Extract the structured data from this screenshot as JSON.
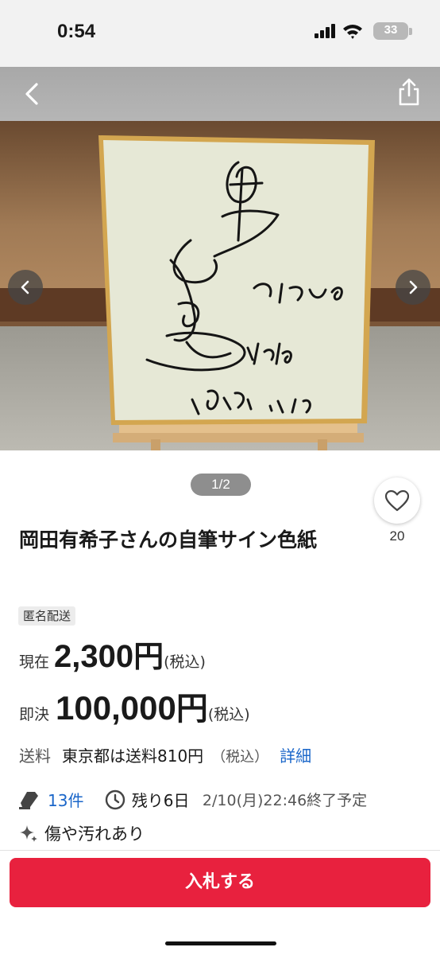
{
  "status_bar": {
    "time": "0:54",
    "battery": "33"
  },
  "photo": {
    "counter": "1/2"
  },
  "like": {
    "count": "20"
  },
  "item": {
    "title": "岡田有希子さんの自筆サイン色紙",
    "tag": "匿名配送"
  },
  "price": {
    "current_label": "現在",
    "current_value": "2,300",
    "buyout_label": "即決",
    "buyout_value": "100,000",
    "currency": "円",
    "tax_note": "(税込)"
  },
  "shipping": {
    "label": "送料",
    "text": "東京都は送料810円",
    "tax_note": "（税込）",
    "detail_link": "詳細"
  },
  "meta": {
    "bids": "13件",
    "remaining": "残り6日",
    "end_time": "2/10(月)22:46終了予定",
    "condition": "傷や汚れあり"
  },
  "action": {
    "bid_label": "入札する"
  },
  "colors": {
    "accent": "#e8213e",
    "link": "#1a66c9"
  }
}
